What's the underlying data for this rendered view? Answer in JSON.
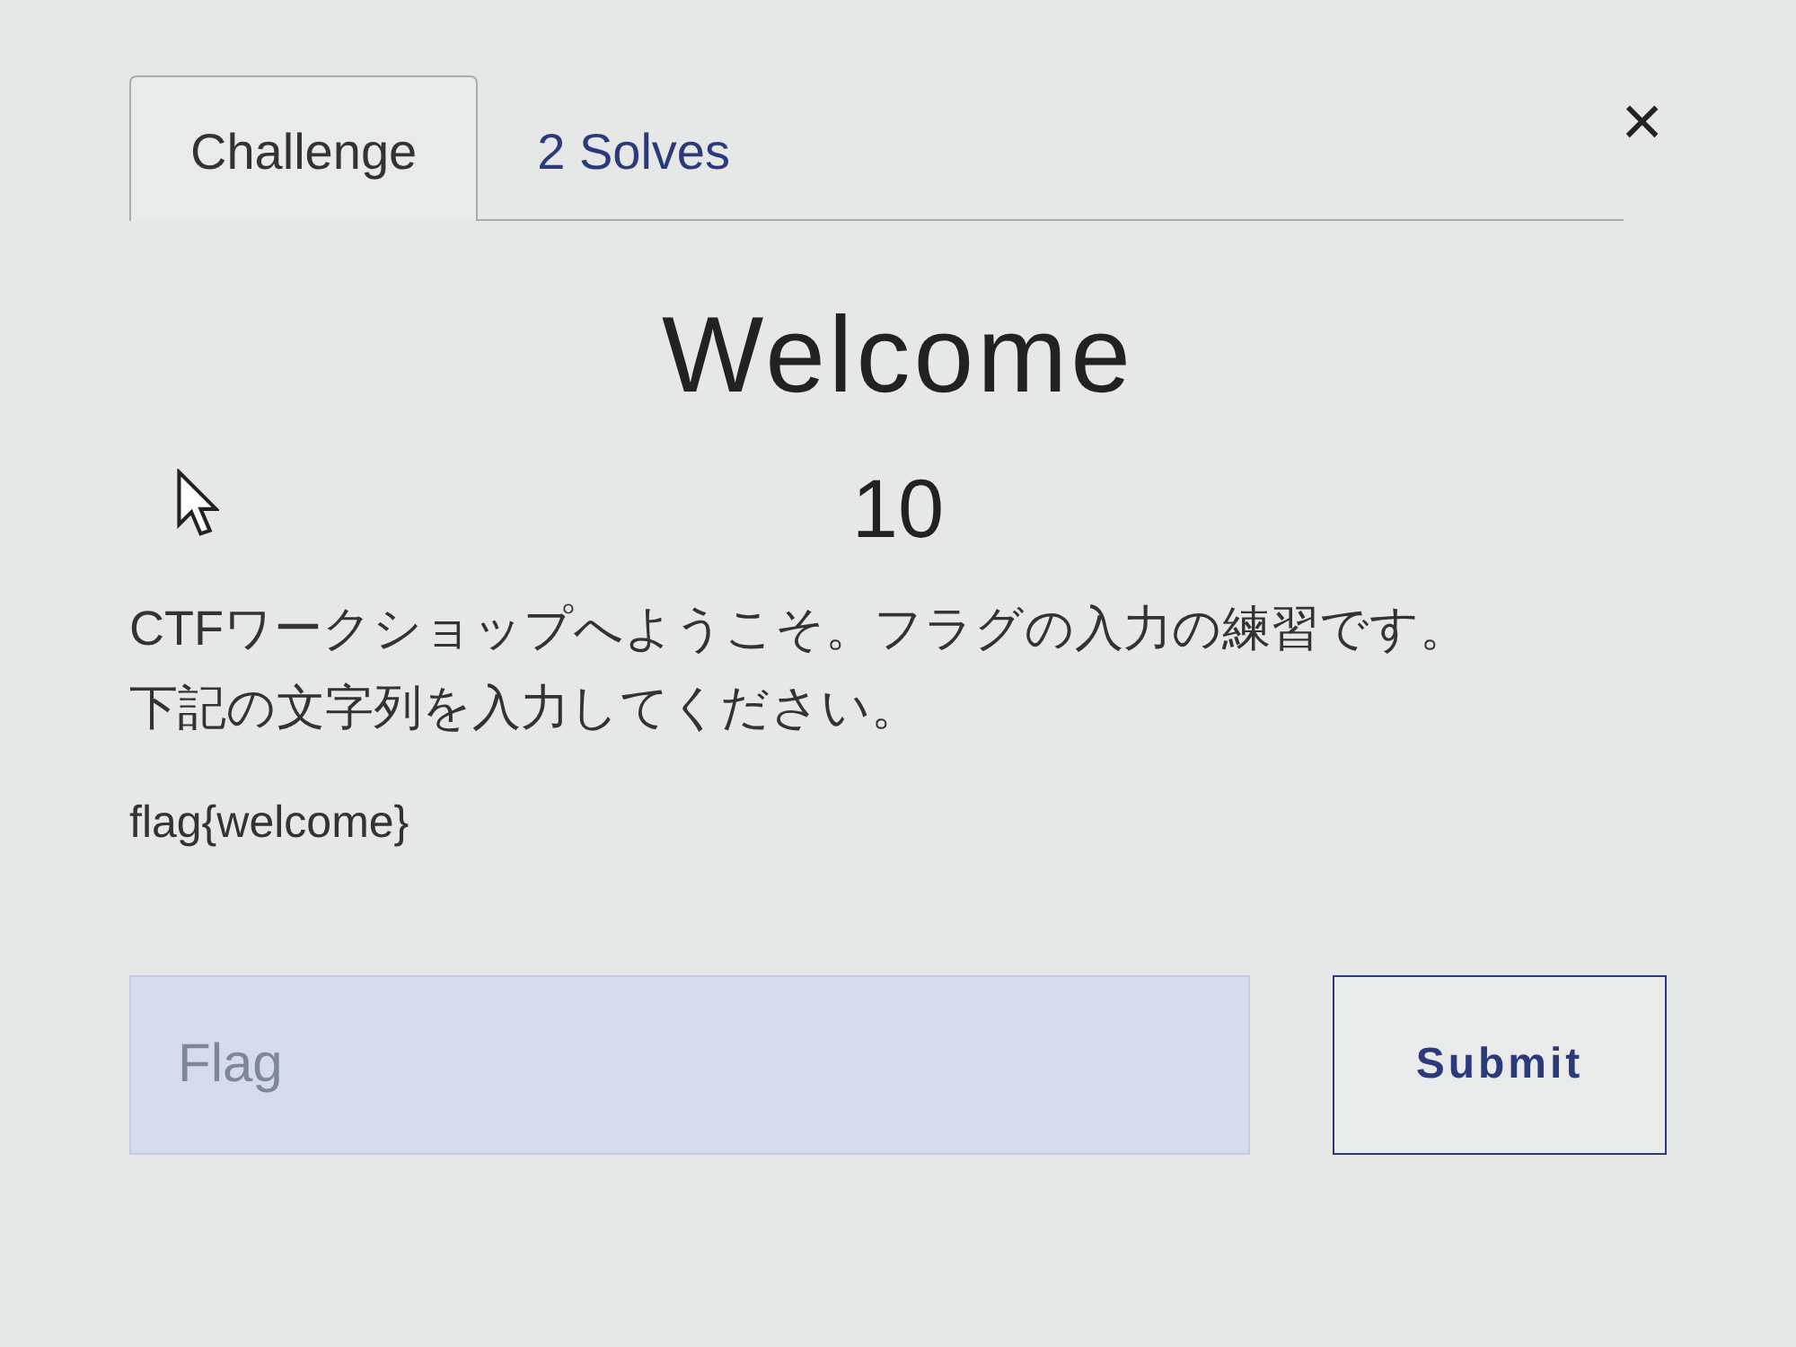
{
  "tabs": [
    {
      "label": "Challenge",
      "selected": true
    },
    {
      "label": "2 Solves",
      "selected": false
    }
  ],
  "close": "×",
  "challenge": {
    "name": "Welcome",
    "value": "10",
    "description": [
      "CTFワークショップへようこそ。フラグの入力の練習です。",
      "下記の文字列を入力してください。"
    ],
    "flag_text": "flag{welcome}"
  },
  "form": {
    "placeholder": "Flag",
    "submit": "Submit"
  }
}
